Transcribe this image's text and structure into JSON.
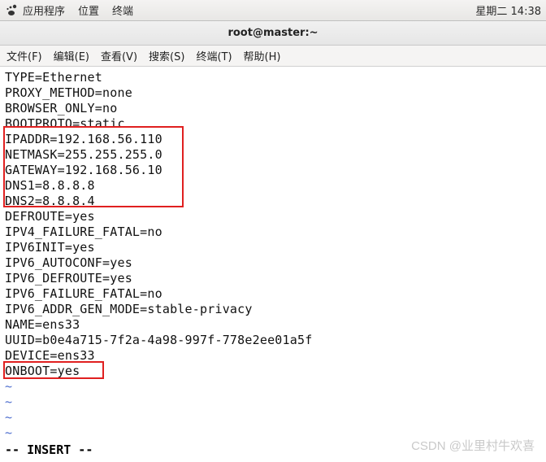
{
  "panel": {
    "apps": "应用程序",
    "places": "位置",
    "terminal": "终端",
    "clock": "星期二 14:38"
  },
  "window": {
    "title": "root@master:~"
  },
  "menu": {
    "file": "文件(F)",
    "edit": "编辑(E)",
    "view": "查看(V)",
    "search": "搜索(S)",
    "terminal": "终端(T)",
    "help": "帮助(H)"
  },
  "config": {
    "lines": [
      "TYPE=Ethernet",
      "PROXY_METHOD=none",
      "BROWSER_ONLY=no",
      "BOOTPROTO=static",
      "IPADDR=192.168.56.110",
      "NETMASK=255.255.255.0",
      "GATEWAY=192.168.56.10",
      "DNS1=8.8.8.8",
      "DNS2=8.8.8.4",
      "DEFROUTE=yes",
      "IPV4_FAILURE_FATAL=no",
      "IPV6INIT=yes",
      "IPV6_AUTOCONF=yes",
      "IPV6_DEFROUTE=yes",
      "IPV6_FAILURE_FATAL=no",
      "IPV6_ADDR_GEN_MODE=stable-privacy",
      "NAME=ens33",
      "UUID=b0e4a715-7f2a-4a98-997f-778e2ee01a5f",
      "DEVICE=ens33",
      "ONBOOT=yes"
    ]
  },
  "vim": {
    "tilde": "~",
    "status": "-- INSERT --"
  },
  "watermark": "CSDN @业里村牛欢喜"
}
